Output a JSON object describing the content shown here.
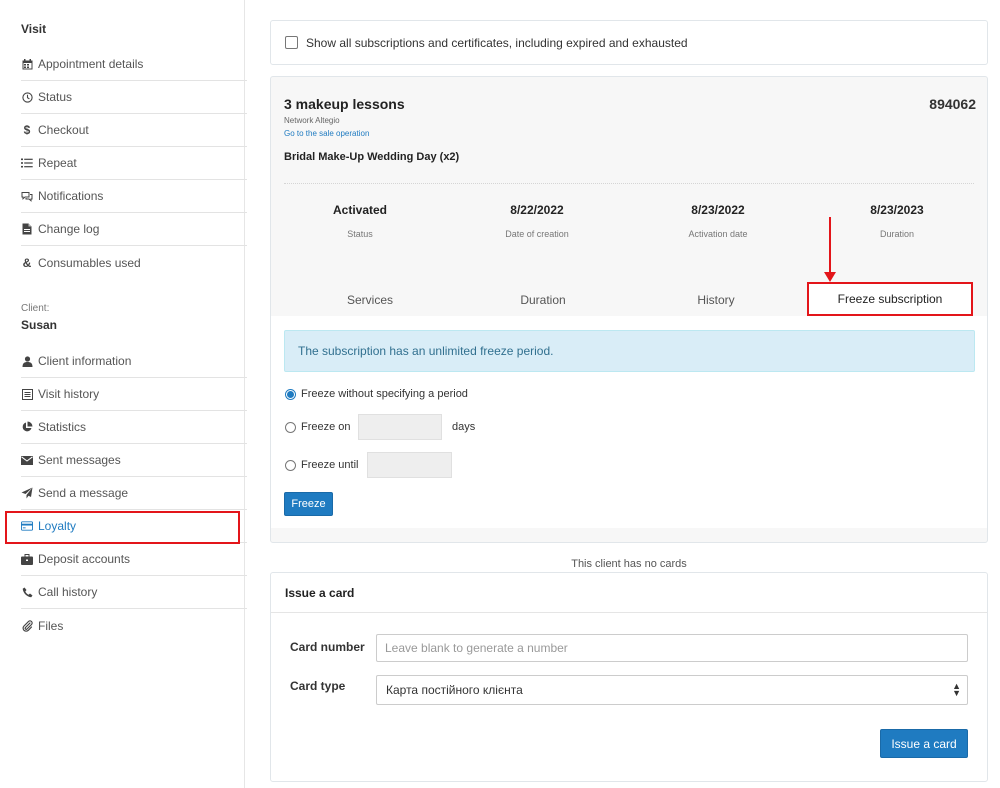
{
  "sidebar": {
    "visit_heading": "Visit",
    "visit_items": [
      {
        "label": "Appointment details",
        "icon": "calendar-icon"
      },
      {
        "label": "Status",
        "icon": "clock-icon"
      },
      {
        "label": "Checkout",
        "icon": "dollar-icon"
      },
      {
        "label": "Repeat",
        "icon": "list-icon"
      },
      {
        "label": "Notifications",
        "icon": "chat-icon"
      },
      {
        "label": "Change log",
        "icon": "file-icon"
      },
      {
        "label": "Consumables used",
        "icon": "ampersand-icon"
      }
    ],
    "client_label": "Client:",
    "client_name": "Susan",
    "client_items": [
      {
        "label": "Client information",
        "icon": "user-icon"
      },
      {
        "label": "Visit history",
        "icon": "list-box-icon"
      },
      {
        "label": "Statistics",
        "icon": "pie-chart-icon"
      },
      {
        "label": "Sent messages",
        "icon": "envelope-icon"
      },
      {
        "label": "Send a message",
        "icon": "paper-plane-icon"
      },
      {
        "label": "Loyalty",
        "icon": "credit-card-icon",
        "active": true
      },
      {
        "label": "Deposit accounts",
        "icon": "briefcase-icon"
      },
      {
        "label": "Call history",
        "icon": "phone-icon"
      },
      {
        "label": "Files",
        "icon": "paperclip-icon"
      }
    ]
  },
  "filter": {
    "show_all_label": "Show all subscriptions and certificates, including expired and exhausted",
    "checked": false
  },
  "subscription": {
    "title": "3 makeup lessons",
    "number": "894062",
    "network": "Network Altegio",
    "sale_link": "Go to the sale operation",
    "service": "Bridal Make-Up Wedding Day (x2)",
    "stats": [
      {
        "value": "Activated",
        "label": "Status"
      },
      {
        "value": "8/22/2022",
        "label": "Date of creation"
      },
      {
        "value": "8/23/2022",
        "label": "Activation date"
      },
      {
        "value": "8/23/2023",
        "label": "Duration"
      }
    ],
    "tabs": [
      "Services",
      "Duration",
      "History",
      "Freeze subscription"
    ],
    "active_tab": "Freeze subscription"
  },
  "freeze": {
    "info": "The subscription has an unlimited freeze period.",
    "option_no_period": "Freeze without specifying a period",
    "option_on": "Freeze on",
    "days_label": "days",
    "option_until": "Freeze until",
    "selected": "no_period",
    "button": "Freeze"
  },
  "cards": {
    "no_cards": "This client has no cards",
    "issue_heading": "Issue a card",
    "card_number_label": "Card number",
    "card_number_placeholder": "Leave blank to generate a number",
    "card_type_label": "Card type",
    "card_type_value": "Карта постійного клієнта",
    "issue_button": "Issue a card"
  },
  "colors": {
    "accent": "#1f7bc1",
    "highlight": "#e3151a",
    "info_bg": "#d9edf7"
  }
}
